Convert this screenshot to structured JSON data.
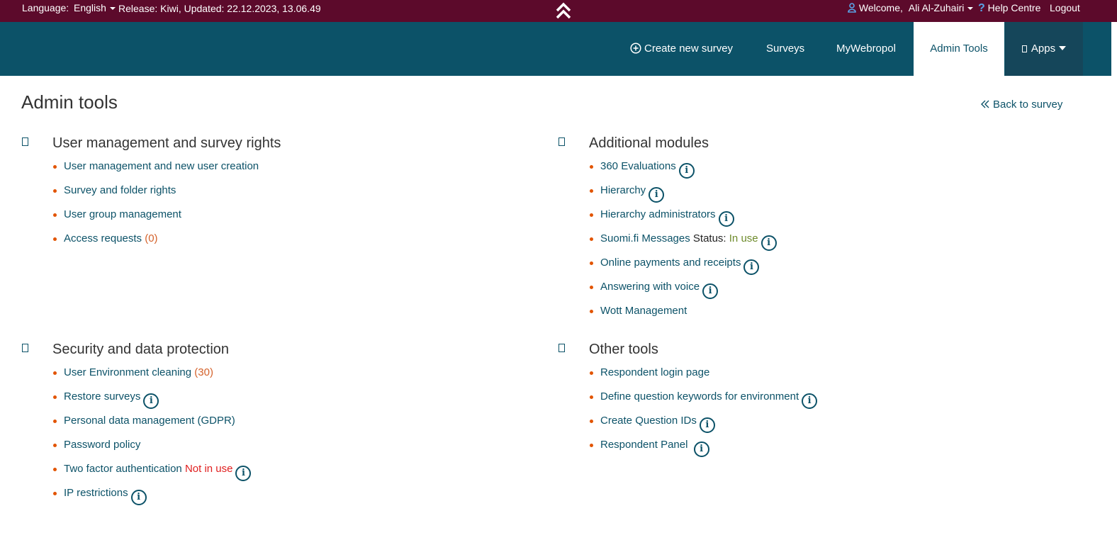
{
  "topbar": {
    "language_label": "Language:",
    "language_value": "English",
    "release": "Release: Kiwi, Updated: 22.12.2023, 13.06.49",
    "welcome_label": "Welcome,",
    "user_name": "Ali Al-Zuhairi",
    "help": "Help Centre",
    "logout": "Logout"
  },
  "nav": {
    "create": "Create new survey",
    "surveys": "Surveys",
    "mywebropol": "MyWebropol",
    "admin": "Admin Tools",
    "apps": "Apps"
  },
  "page": {
    "title": "Admin tools",
    "back": "Back to survey"
  },
  "sections": {
    "user": {
      "title": "User management and survey rights",
      "items": [
        {
          "label": "User management and new user creation"
        },
        {
          "label": "Survey and folder rights"
        },
        {
          "label": "User group management"
        },
        {
          "label": "Access requests",
          "count": "(0)"
        }
      ]
    },
    "modules": {
      "title": "Additional modules",
      "items": [
        {
          "label": "360 Evaluations"
        },
        {
          "label": "Hierarchy"
        },
        {
          "label": "Hierarchy administrators"
        },
        {
          "label": "Suomi.fi Messages",
          "status_label": "Status:",
          "status": "In use"
        },
        {
          "label": "Online payments and receipts"
        },
        {
          "label": "Answering with voice"
        },
        {
          "label": "Wott Management"
        }
      ]
    },
    "security": {
      "title": "Security and data protection",
      "items": [
        {
          "label": "User Environment cleaning",
          "count": "(30)"
        },
        {
          "label": "Restore surveys"
        },
        {
          "label": "Personal data management (GDPR)"
        },
        {
          "label": "Password policy"
        },
        {
          "label": "Two factor authentication",
          "status": "Not in use"
        },
        {
          "label": "IP restrictions"
        }
      ]
    },
    "other": {
      "title": "Other tools",
      "items": [
        {
          "label": "Respondent login page"
        },
        {
          "label": "Define question keywords for environment"
        },
        {
          "label": "Create Question IDs"
        },
        {
          "label": "Respondent Panel"
        }
      ]
    }
  },
  "colors": {
    "topbar": "#5c0a2b",
    "navbar": "#0c5268",
    "bullet": "#e25400",
    "link": "#0c5268",
    "status_ok": "#6e8b2c",
    "status_bad": "#e02020"
  }
}
